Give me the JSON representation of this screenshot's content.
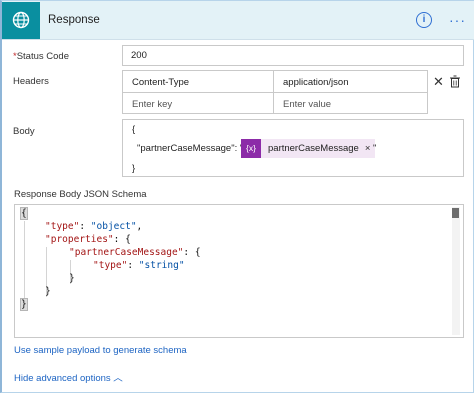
{
  "header": {
    "title": "Response",
    "info_glyph": "i",
    "more_glyph": "···"
  },
  "status_code": {
    "required_mark": "*",
    "label": "Status Code",
    "value": "200"
  },
  "headers": {
    "label": "Headers",
    "rows": [
      {
        "key": "Content-Type",
        "value": "application/json"
      }
    ],
    "key_placeholder": "Enter key",
    "value_placeholder": "Enter value"
  },
  "body": {
    "label": "Body",
    "open_brace": "{",
    "prop_prefix": "\"partnerCaseMessage\": \"",
    "token_icon": "{x}",
    "token_text": "partnerCaseMessage",
    "token_close": "×",
    "prop_suffix": "\"",
    "close_brace": "}"
  },
  "schema": {
    "label": "Response Body JSON Schema",
    "lines": {
      "l1": "{",
      "l2_key": "\"type\"",
      "l2_sep": ": ",
      "l2_val": "\"object\"",
      "l2_end": ",",
      "l3_key": "\"properties\"",
      "l3_sep": ": {",
      "l4_key": "\"partnerCaseMessage\"",
      "l4_sep": ": {",
      "l5_key": "\"type\"",
      "l5_sep": ": ",
      "l5_val": "\"string\"",
      "l6": "}",
      "l7": "}",
      "l8": "}"
    }
  },
  "links": {
    "sample_payload": "Use sample payload to generate schema",
    "hide_advanced": "Hide advanced options",
    "hide_chevron": "︿"
  },
  "colors": {
    "header_bg": "#e3f2f7",
    "app_icon_bg": "#0a8fa0",
    "accent": "#2f6fd3",
    "token_purple": "#8c2ba8",
    "link": "#1d64c3"
  },
  "icons": [
    "globe-icon",
    "info-icon",
    "more-icon",
    "close-icon",
    "delete-icon",
    "variable-token-icon",
    "chevron-up-icon"
  ]
}
